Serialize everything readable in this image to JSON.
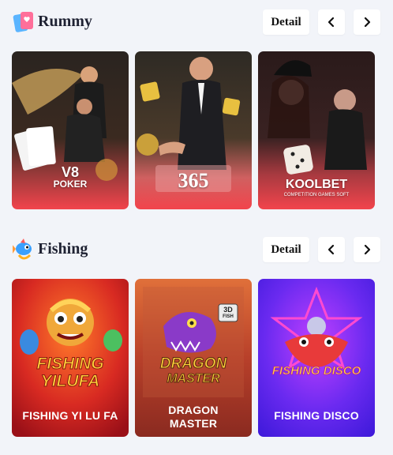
{
  "sections": [
    {
      "title": "Rummy",
      "icon": "cards-icon",
      "detail_label": "Detail",
      "games": [
        {
          "brand": "V8",
          "brand_sub": "POKER"
        },
        {
          "brand": "365"
        },
        {
          "brand": "KOOLBET",
          "brand_sub": "COMPETITION GAMES SOFT"
        }
      ]
    },
    {
      "title": "Fishing",
      "icon": "fish-icon",
      "detail_label": "Detail",
      "games": [
        {
          "logo_lines": [
            "FISHING",
            "YILUFA"
          ],
          "name": "FISHING YI LU FA"
        },
        {
          "logo_lines": [
            "DRAGON",
            "MASTER"
          ],
          "badge_top": "3D",
          "badge_bottom": "FISH",
          "name_lines": [
            "DRAGON",
            "MASTER"
          ]
        },
        {
          "logo_text": "FISHING DISCO",
          "name": "FISHING DISCO"
        }
      ]
    }
  ],
  "icons": {
    "prev": "chevron-left-icon",
    "next": "chevron-right-icon"
  },
  "colors": {
    "page_background": "#f2f4f9",
    "rummy_card_gradient_bottom": "#f2444c",
    "fishing_yilufa": "#c81f2a",
    "fishing_dragon": "#c6492a",
    "fishing_disco": "#5a22e6"
  }
}
